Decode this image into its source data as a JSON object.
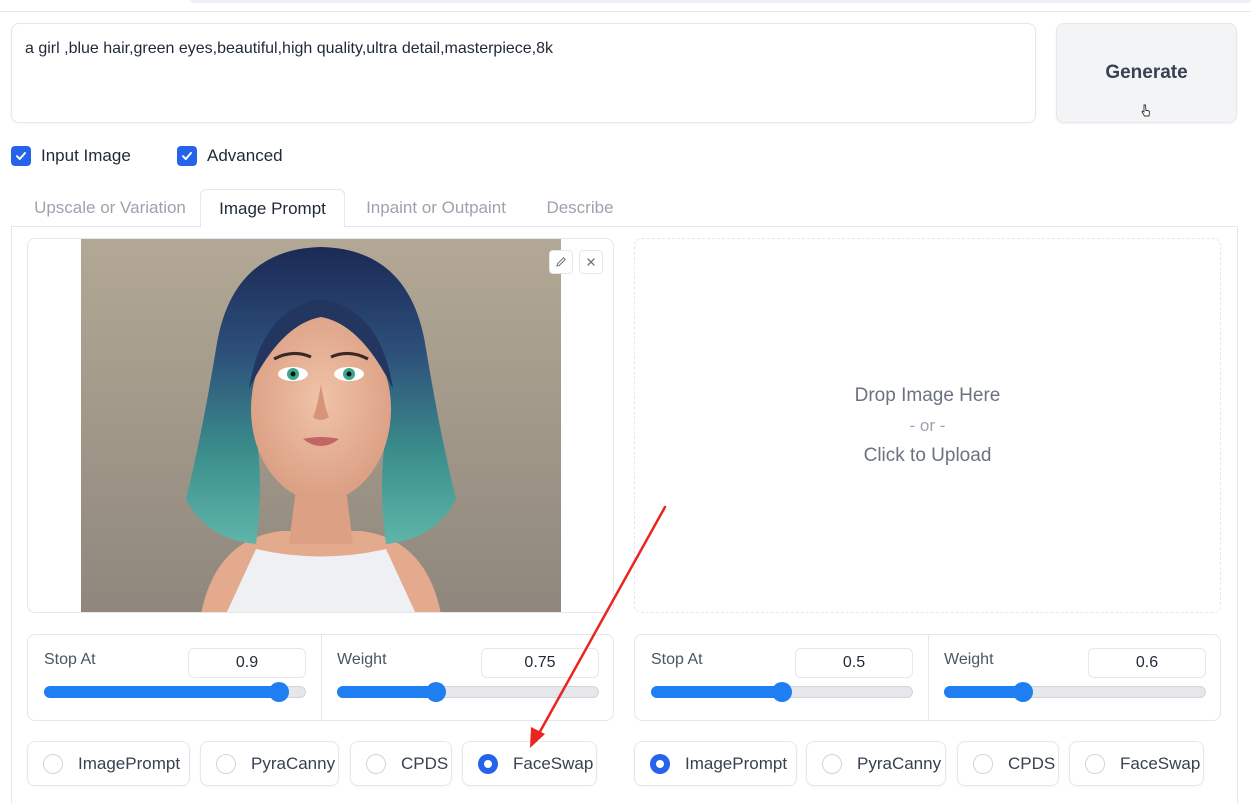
{
  "prompt": {
    "value": "a girl ,blue hair,green eyes,beautiful,high quality,ultra detail,masterpiece,8k"
  },
  "generate": {
    "label": "Generate"
  },
  "options": {
    "input_image": {
      "label": "Input Image",
      "checked": true
    },
    "advanced": {
      "label": "Advanced",
      "checked": true
    }
  },
  "tabs": [
    {
      "label": "Upscale or Variation",
      "active": false
    },
    {
      "label": "Image Prompt",
      "active": true
    },
    {
      "label": "Inpaint or Outpaint",
      "active": false
    },
    {
      "label": "Describe",
      "active": false
    }
  ],
  "left_slot": {
    "image_icons": [
      "pencil-icon",
      "close-icon"
    ],
    "stop_at": {
      "label": "Stop At",
      "value": "0.9",
      "fraction": 0.9
    },
    "weight": {
      "label": "Weight",
      "value": "0.75",
      "fraction": 0.375
    },
    "types": [
      {
        "label": "ImagePrompt",
        "selected": false
      },
      {
        "label": "PyraCanny",
        "selected": false
      },
      {
        "label": "CPDS",
        "selected": false
      },
      {
        "label": "FaceSwap",
        "selected": true
      }
    ]
  },
  "right_slot": {
    "drop": {
      "line1": "Drop Image Here",
      "line2": "- or -",
      "line3": "Click to Upload"
    },
    "stop_at": {
      "label": "Stop At",
      "value": "0.5",
      "fraction": 0.5
    },
    "weight": {
      "label": "Weight",
      "value": "0.6",
      "fraction": 0.3
    },
    "types": [
      {
        "label": "ImagePrompt",
        "selected": true
      },
      {
        "label": "PyraCanny",
        "selected": false
      },
      {
        "label": "CPDS",
        "selected": false
      },
      {
        "label": "FaceSwap",
        "selected": false
      }
    ]
  },
  "colors": {
    "accent": "#2563eb",
    "slider": "#1f7ef2",
    "annotation_arrow": "#e8251f"
  }
}
